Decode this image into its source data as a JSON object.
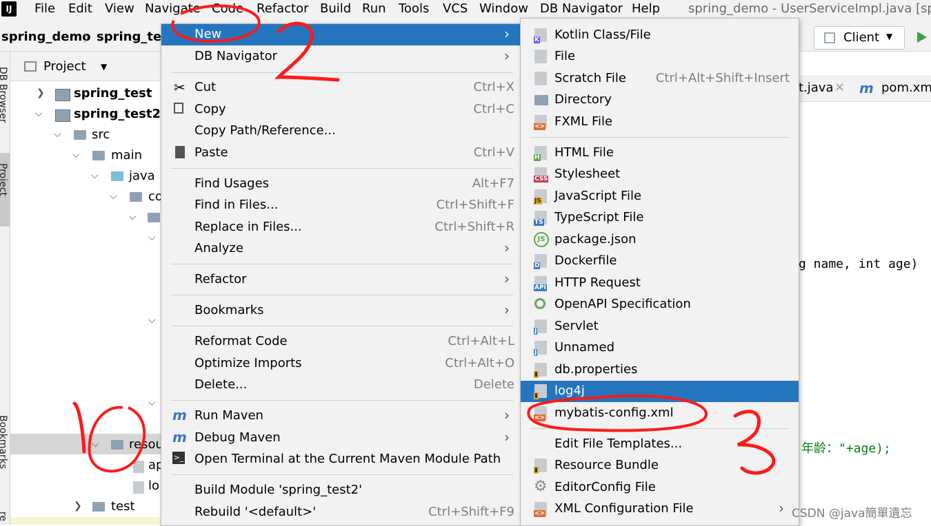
{
  "menubar": {
    "items": [
      "File",
      "Edit",
      "View",
      "Navigate",
      "Code",
      "Refactor",
      "Build",
      "Run",
      "Tools",
      "VCS",
      "Window",
      "DB Navigator",
      "Help"
    ],
    "window_title": "spring_demo - UserServiceImpl.java [sprin"
  },
  "navbar": {
    "crumb1": "spring_demo",
    "crumb2": "spring_tes",
    "run_config": "Client"
  },
  "sidebar": {
    "db_browser": "DB Browser",
    "project": "Project",
    "bookmarks": "Bookmarks",
    "structure": "re"
  },
  "project_panel": {
    "title": "Project",
    "tree": [
      "spring_test",
      "spring_test2",
      "src",
      "main",
      "java",
      "co",
      "ap",
      "lo",
      "resou",
      "test"
    ]
  },
  "editor": {
    "tab1": "t.java",
    "tab2": "pom.xml",
    "code_line1": "g name, int age)",
    "code_line2": "年龄：\"+age);"
  },
  "context_menu": {
    "items": [
      {
        "label": "New",
        "shortcut": "",
        "submenu": true,
        "selected": true
      },
      {
        "label": "DB Navigator",
        "shortcut": "",
        "submenu": true
      },
      {
        "label": "Cut",
        "shortcut": "Ctrl+X"
      },
      {
        "label": "Copy",
        "shortcut": "Ctrl+C"
      },
      {
        "label": "Copy Path/Reference...",
        "shortcut": ""
      },
      {
        "label": "Paste",
        "shortcut": "Ctrl+V"
      },
      {
        "label": "Find Usages",
        "shortcut": "Alt+F7"
      },
      {
        "label": "Find in Files...",
        "shortcut": "Ctrl+Shift+F"
      },
      {
        "label": "Replace in Files...",
        "shortcut": "Ctrl+Shift+R"
      },
      {
        "label": "Analyze",
        "shortcut": "",
        "submenu": true
      },
      {
        "label": "Refactor",
        "shortcut": "",
        "submenu": true
      },
      {
        "label": "Bookmarks",
        "shortcut": "",
        "submenu": true
      },
      {
        "label": "Reformat Code",
        "shortcut": "Ctrl+Alt+L"
      },
      {
        "label": "Optimize Imports",
        "shortcut": "Ctrl+Alt+O"
      },
      {
        "label": "Delete...",
        "shortcut": "Delete"
      },
      {
        "label": "Run Maven",
        "shortcut": "",
        "submenu": true
      },
      {
        "label": "Debug Maven",
        "shortcut": "",
        "submenu": true
      },
      {
        "label": "Open Terminal at the Current Maven Module Path",
        "shortcut": ""
      },
      {
        "label": "Build Module 'spring_test2'",
        "shortcut": ""
      },
      {
        "label": "Rebuild '<default>'",
        "shortcut": "Ctrl+Shift+F9"
      }
    ]
  },
  "new_submenu": {
    "items": [
      {
        "label": "Kotlin Class/File",
        "icon": "kotlin-icon"
      },
      {
        "label": "File",
        "icon": "file-icon"
      },
      {
        "label": "Scratch File",
        "icon": "scratch-file-icon",
        "shortcut": "Ctrl+Alt+Shift+Insert"
      },
      {
        "label": "Directory",
        "icon": "folder-icon"
      },
      {
        "label": "FXML File",
        "icon": "fxml-icon"
      },
      {
        "label": "HTML File",
        "icon": "html-icon"
      },
      {
        "label": "Stylesheet",
        "icon": "css-icon"
      },
      {
        "label": "JavaScript File",
        "icon": "js-icon"
      },
      {
        "label": "TypeScript File",
        "icon": "ts-icon"
      },
      {
        "label": "package.json",
        "icon": "nodejs-icon"
      },
      {
        "label": "Dockerfile",
        "icon": "docker-icon"
      },
      {
        "label": "HTTP Request",
        "icon": "api-icon"
      },
      {
        "label": "OpenAPI Specification",
        "icon": "openapi-icon"
      },
      {
        "label": "Servlet",
        "icon": "servlet-icon"
      },
      {
        "label": "Unnamed",
        "icon": "unnamed-icon"
      },
      {
        "label": "db.properties",
        "icon": "properties-icon"
      },
      {
        "label": "log4j",
        "icon": "properties-icon",
        "selected": true
      },
      {
        "label": "mybatis-config.xml",
        "icon": "xml-icon"
      },
      {
        "label": "Edit File Templates...",
        "icon": ""
      },
      {
        "label": "Resource Bundle",
        "icon": "properties-icon"
      },
      {
        "label": "EditorConfig File",
        "icon": "gear-icon"
      },
      {
        "label": "XML Configuration File",
        "icon": "xml-icon",
        "submenu": true
      }
    ]
  },
  "annotations": {
    "mark1": "1",
    "mark2": "2",
    "mark3": "3"
  },
  "watermark": "CSDN @java簡單遺忘",
  "colors": {
    "selection": "#2675bf",
    "menu_bg": "#f2f2f2",
    "annotation_red": "#ff1a1a"
  }
}
